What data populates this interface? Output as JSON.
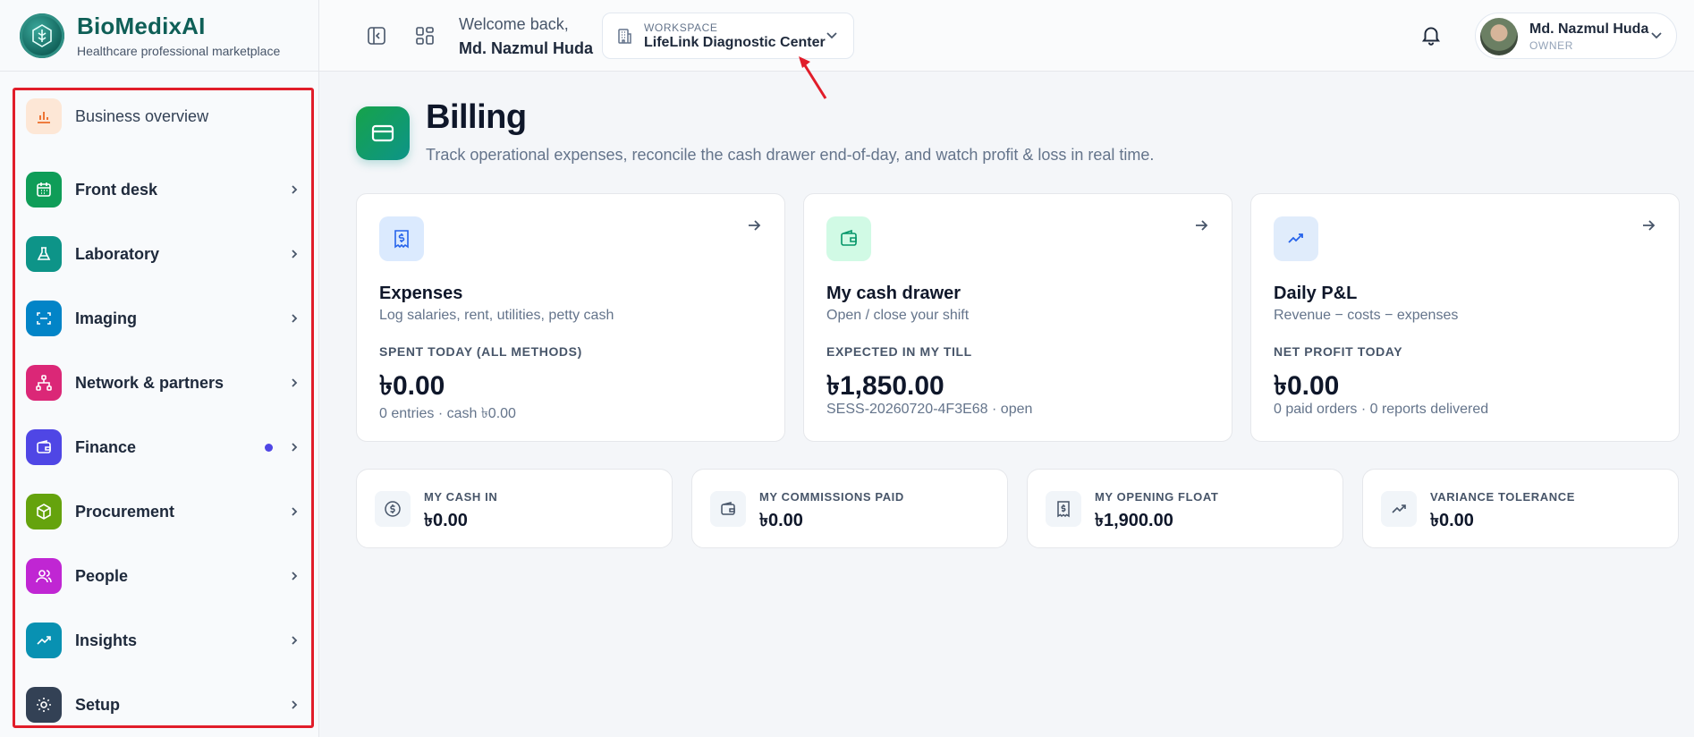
{
  "brand": {
    "name": "BioMedixAI",
    "tagline": "Healthcare professional marketplace"
  },
  "sidebar": {
    "items": [
      {
        "label": "Business overview",
        "icon": "bar-chart-icon",
        "color": "#fde7d6"
      },
      {
        "label": "Front desk",
        "icon": "calendar-icon",
        "color": "#0f9d58"
      },
      {
        "label": "Laboratory",
        "icon": "flask-icon",
        "color": "#0d9488"
      },
      {
        "label": "Imaging",
        "icon": "scan-icon",
        "color": "#0284c7"
      },
      {
        "label": "Network & partners",
        "icon": "network-icon",
        "color": "#db2777"
      },
      {
        "label": "Finance",
        "icon": "wallet-icon",
        "color": "#4f46e5"
      },
      {
        "label": "Procurement",
        "icon": "box-icon",
        "color": "#65a30d"
      },
      {
        "label": "People",
        "icon": "users-icon",
        "color": "#c026d3"
      },
      {
        "label": "Insights",
        "icon": "trend-icon",
        "color": "#0891b2"
      },
      {
        "label": "Setup",
        "icon": "gear-icon",
        "color": "#334155"
      }
    ]
  },
  "header": {
    "welcome": "Welcome back,",
    "user_short": "Md. Nazmul Huda",
    "workspace_label": "WORKSPACE",
    "workspace_value": "LifeLink Diagnostic Center",
    "user_name": "Md. Nazmul Huda",
    "user_role": "OWNER"
  },
  "page": {
    "title": "Billing",
    "subtitle": "Track operational expenses, reconcile the cash drawer end-of-day, and watch profit & loss in real time."
  },
  "cards": [
    {
      "title": "Expenses",
      "desc": "Log salaries, rent, utilities, petty cash",
      "metric_label": "SPENT TODAY (ALL METHODS)",
      "metric": "৳0.00",
      "foot": "0 entries · cash ৳0.00"
    },
    {
      "title": "My cash drawer",
      "desc": "Open / close your shift",
      "metric_label": "EXPECTED IN MY TILL",
      "metric": "৳1,850.00",
      "foot": "SESS-20260720-4F3E68 · open"
    },
    {
      "title": "Daily P&L",
      "desc": "Revenue − costs − expenses",
      "metric_label": "NET PROFIT TODAY",
      "metric": "৳0.00",
      "foot": "0 paid orders · 0 reports delivered"
    }
  ],
  "mini_cards": [
    {
      "label": "MY CASH IN",
      "value": "৳0.00"
    },
    {
      "label": "MY COMMISSIONS PAID",
      "value": "৳0.00"
    },
    {
      "label": "MY OPENING FLOAT",
      "value": "৳1,900.00"
    },
    {
      "label": "VARIANCE TOLERANCE",
      "value": "৳0.00"
    }
  ]
}
